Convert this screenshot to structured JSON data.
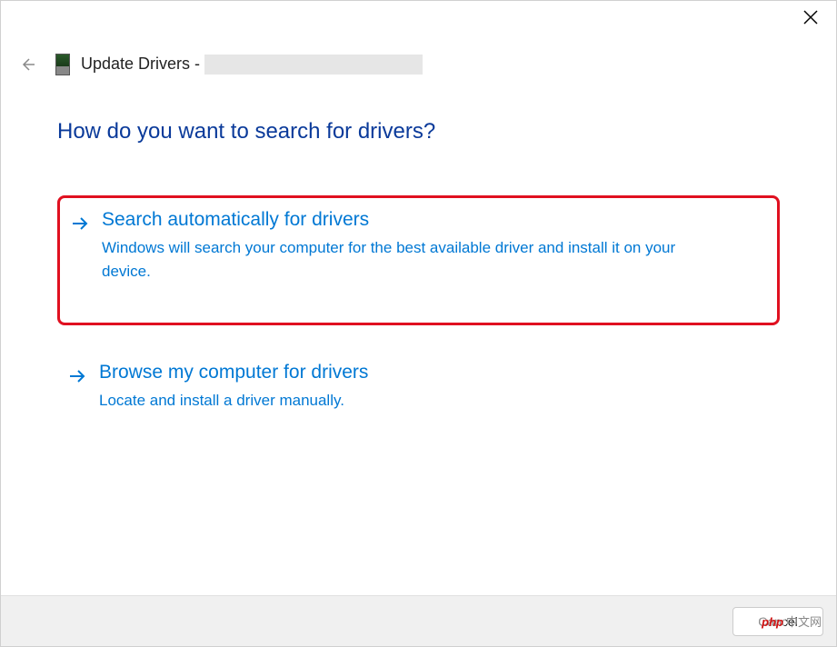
{
  "header": {
    "title_prefix": "Update Drivers - "
  },
  "question": "How do you want to search for drivers?",
  "options": [
    {
      "title": "Search automatically for drivers",
      "description": "Windows will search your computer for the best available driver and install it on your device.",
      "highlighted": true
    },
    {
      "title": "Browse my computer for drivers",
      "description": "Locate and install a driver manually.",
      "highlighted": false
    }
  ],
  "footer": {
    "cancel_label": "Cancel"
  },
  "watermark": {
    "brand": "php",
    "suffix": "中文网"
  }
}
